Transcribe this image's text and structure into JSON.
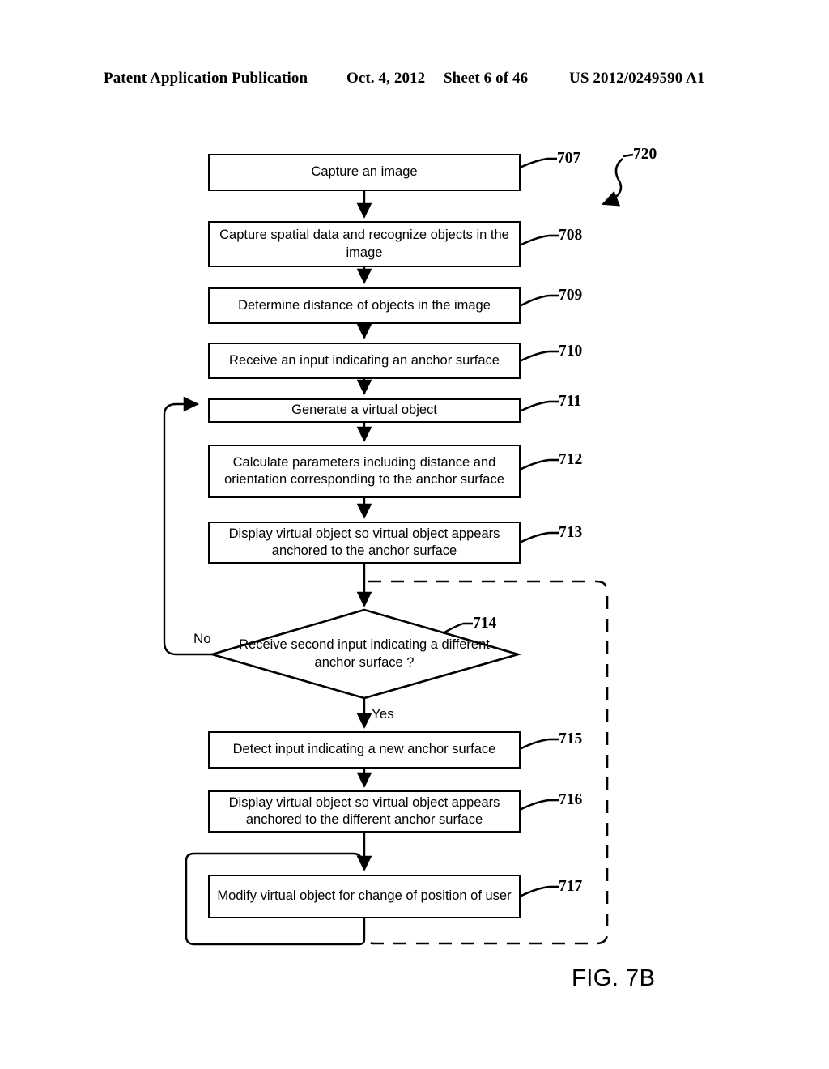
{
  "header": {
    "title": "Patent Application Publication",
    "date": "Oct. 4, 2012",
    "sheet": "Sheet 6 of 46",
    "publication_number": "US 2012/0249590 A1"
  },
  "figure": {
    "caption": "FIG. 7B",
    "diagram_reference": "720",
    "type": "flowchart"
  },
  "nodes": [
    {
      "ref": "707",
      "shape": "process",
      "text": "Capture an image"
    },
    {
      "ref": "708",
      "shape": "process",
      "text": "Capture spatial data and recognize objects in the image"
    },
    {
      "ref": "709",
      "shape": "process",
      "text": "Determine distance of objects in the image"
    },
    {
      "ref": "710",
      "shape": "process",
      "text": "Receive an input indicating an anchor surface"
    },
    {
      "ref": "711",
      "shape": "process",
      "text": "Generate a virtual object"
    },
    {
      "ref": "712",
      "shape": "process",
      "text": "Calculate parameters including distance and orientation corresponding to the anchor surface"
    },
    {
      "ref": "713",
      "shape": "process",
      "text": "Display virtual object so virtual object appears anchored to the anchor surface"
    },
    {
      "ref": "714",
      "shape": "decision",
      "text": "Receive second input indicating a different anchor surface ?"
    },
    {
      "ref": "715",
      "shape": "process",
      "text": "Detect input indicating a new anchor surface"
    },
    {
      "ref": "716",
      "shape": "process",
      "text": "Display virtual object so virtual object appears anchored to the different  anchor surface"
    },
    {
      "ref": "717",
      "shape": "process",
      "text": "Modify virtual object for change of position of user"
    }
  ],
  "branch_labels": {
    "no": "No",
    "yes": "Yes"
  },
  "colors": {
    "ink": "#000000",
    "paper": "#ffffff"
  }
}
